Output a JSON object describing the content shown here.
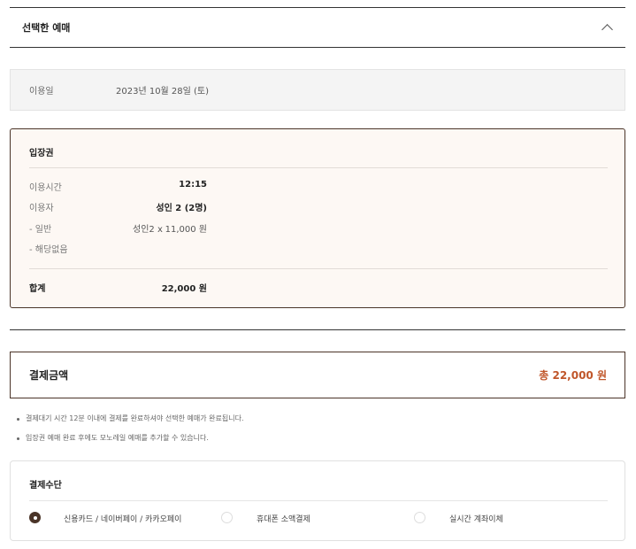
{
  "section": {
    "title": "선택한 예매",
    "toggle_icon": "chevron-up-icon"
  },
  "visit": {
    "label": "이용일",
    "value": "2023년 10월 28일 (토)"
  },
  "ticket": {
    "title": "입장권",
    "rows": {
      "time": {
        "label": "이용시간",
        "value": "12:15"
      },
      "users": {
        "label": "이용자",
        "value": "성인 2 (2명)"
      },
      "general": {
        "label": "- 일반",
        "qty": "성인2 x",
        "price": "11,000 원"
      },
      "none": {
        "label": "- 해당없음"
      }
    },
    "total": {
      "label": "합계",
      "value": "22,000 원"
    }
  },
  "payment": {
    "label": "결제금액",
    "amount": "총 22,000 원"
  },
  "notes": [
    "결제대기 시간 12분 이내에 결제를 완료하셔야 선택한 예매가 완료됩니다.",
    "입장권 예매 완료 후에도 모노레일 예매를 추가할 수 있습니다."
  ],
  "methods": {
    "title": "결제수단",
    "options": [
      {
        "label": "신용카드 / 네이버페이 / 카카오페이",
        "selected": true
      },
      {
        "label": "휴대폰 소액결제",
        "selected": false
      },
      {
        "label": "실시간 계좌이체",
        "selected": false
      }
    ]
  },
  "colors": {
    "accent": "#4a3428",
    "amount": "#c0562a",
    "ticket_bg": "#fdf8f4"
  }
}
